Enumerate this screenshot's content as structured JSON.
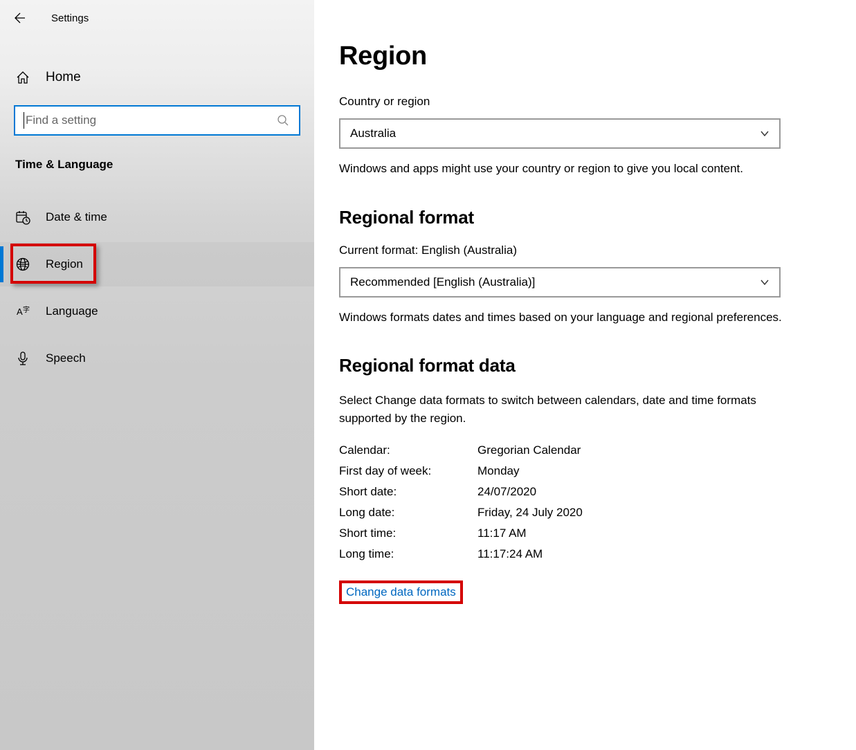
{
  "titlebar": {
    "app_title": "Settings"
  },
  "sidebar": {
    "home_label": "Home",
    "search_placeholder": "Find a setting",
    "section_title": "Time & Language",
    "items": [
      {
        "label": "Date & time",
        "icon": "calendar-clock-icon"
      },
      {
        "label": "Region",
        "icon": "globe-icon"
      },
      {
        "label": "Language",
        "icon": "language-icon"
      },
      {
        "label": "Speech",
        "icon": "microphone-icon"
      }
    ]
  },
  "main": {
    "page_title": "Region",
    "country_label": "Country or region",
    "country_value": "Australia",
    "country_desc": "Windows and apps might use your country or region to give you local content.",
    "regional_format_heading": "Regional format",
    "current_format_label": "Current format: English (Australia)",
    "format_value": "Recommended [English (Australia)]",
    "format_desc": "Windows formats dates and times based on your language and regional preferences.",
    "format_data_heading": "Regional format data",
    "format_data_desc": "Select Change data formats to switch between calendars, date and time formats supported by the region.",
    "data": [
      {
        "key": "Calendar:",
        "value": "Gregorian Calendar"
      },
      {
        "key": "First day of week:",
        "value": "Monday"
      },
      {
        "key": "Short date:",
        "value": "24/07/2020"
      },
      {
        "key": "Long date:",
        "value": "Friday, 24 July 2020"
      },
      {
        "key": "Short time:",
        "value": "11:17 AM"
      },
      {
        "key": "Long time:",
        "value": "11:17:24 AM"
      }
    ],
    "change_link": "Change data formats"
  }
}
